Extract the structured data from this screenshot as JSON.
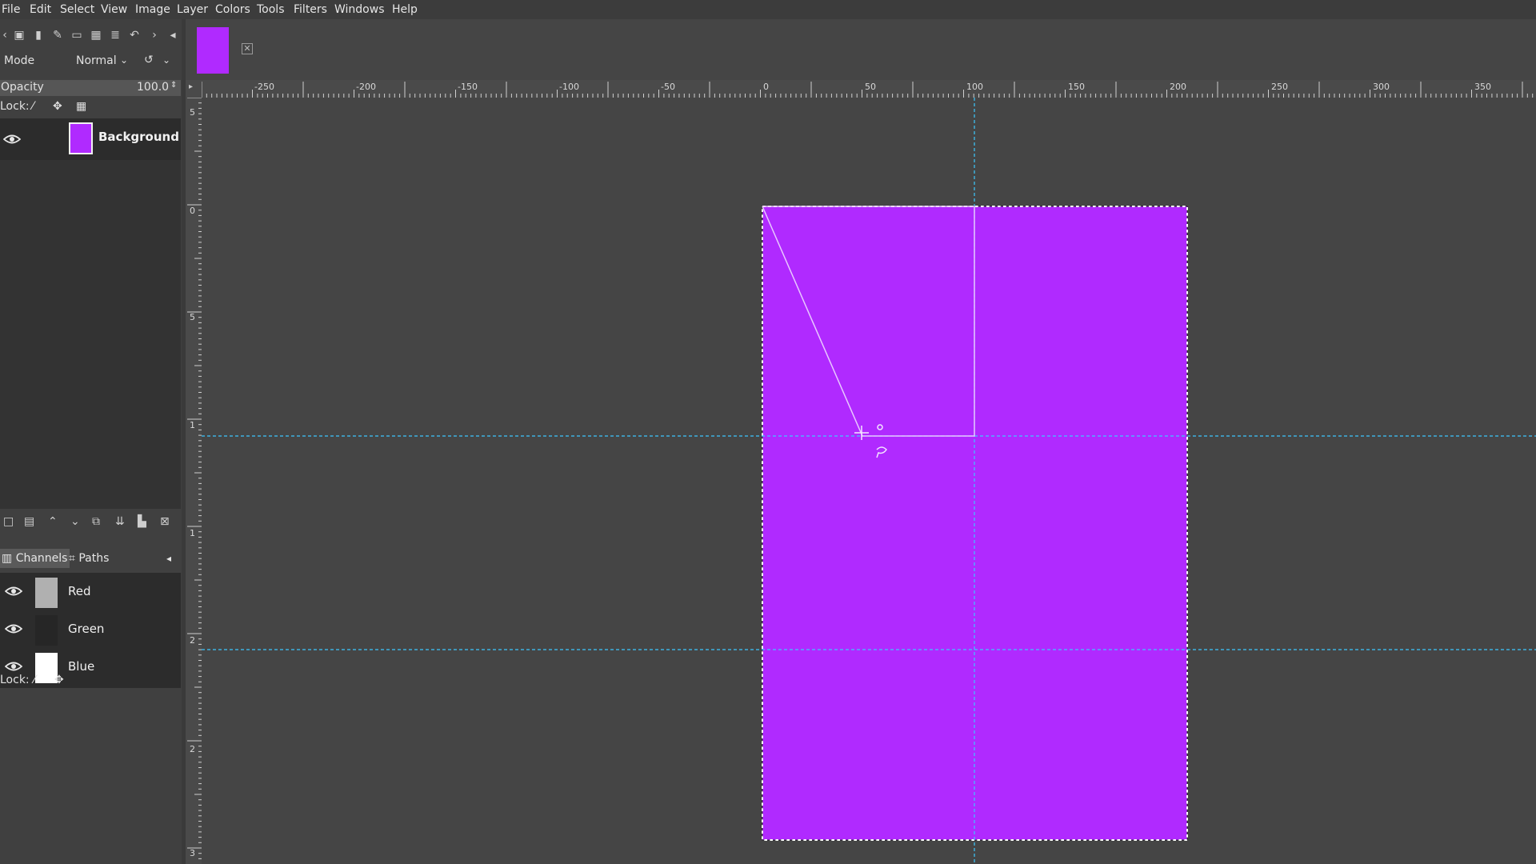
{
  "menu": [
    "File",
    "Edit",
    "Select",
    "View",
    "Image",
    "Layer",
    "Colors",
    "Tools",
    "Filters",
    "Windows",
    "Help"
  ],
  "layers_panel": {
    "mode_label": "Mode",
    "mode_value": "Normal",
    "opacity_label": "Opacity",
    "opacity_value": "100.0",
    "lock_label": "Lock:",
    "layers": [
      {
        "name": "Background",
        "visible": true
      }
    ]
  },
  "dock_tabs": {
    "channels": "Channels",
    "paths": "Paths"
  },
  "channels": [
    {
      "name": "Red",
      "visible": true
    },
    {
      "name": "Green",
      "visible": true
    },
    {
      "name": "Blue",
      "visible": true
    }
  ],
  "channels_lock_label": "Lock:",
  "rulers": {
    "horizontal": [
      "-250",
      "-200",
      "-150",
      "-100",
      "-50",
      "0",
      "50",
      "100",
      "150",
      "200",
      "250",
      "300",
      "350"
    ],
    "vertical": [
      "5",
      "0",
      "5",
      "1",
      "1",
      "2",
      "2",
      "3"
    ]
  },
  "colors": {
    "image_fill": "#b02aff",
    "guide": "#3cc8ff"
  }
}
